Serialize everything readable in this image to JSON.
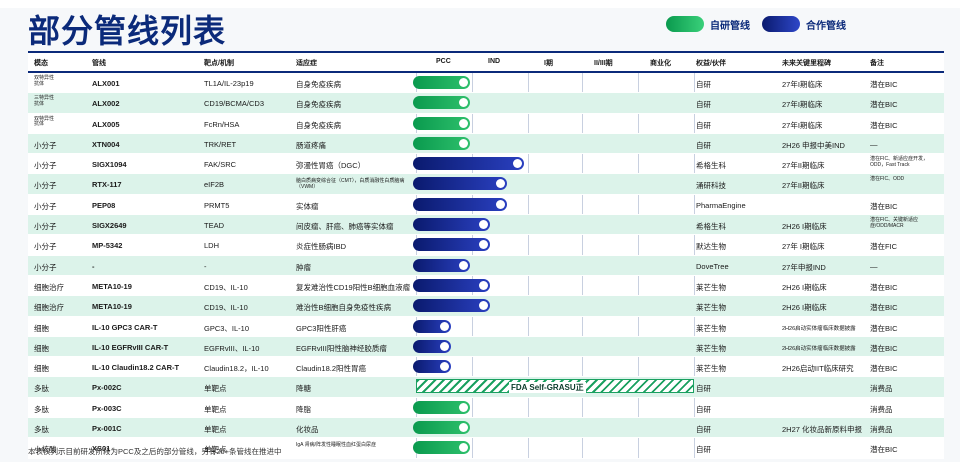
{
  "title": "部分管线列表",
  "legend": {
    "own": "自研管线",
    "coop": "合作管线"
  },
  "headers": {
    "modality": "模态",
    "pipeline": "管线",
    "target": "靶点/机制",
    "indication": "适应症",
    "pcc": "PCC",
    "ind": "IND",
    "phase1": "I期",
    "phase23": "II/III期",
    "commercial": "商业化",
    "partner": "权益/伙伴",
    "milestone": "未来关键里程碑",
    "note": "备注"
  },
  "rows": [
    {
      "modality": "双特异性抗体",
      "pipeline": "ALX001",
      "target": "TL1A/IL-23p19",
      "indication": "自身免疫疾病",
      "type": "own",
      "progress": 0.305,
      "partner": "自研",
      "milestone": "27年I期临床",
      "note": "潜在BIC"
    },
    {
      "modality": "三特异性抗体",
      "pipeline": "ALX002",
      "target": "CD19/BCMA/CD3",
      "indication": "自身免疫疾病",
      "type": "own",
      "progress": 0.305,
      "partner": "自研",
      "milestone": "27年I期临床",
      "note": "潜在BIC"
    },
    {
      "modality": "双特异性抗体",
      "pipeline": "ALX005",
      "target": "FcRn/HSA",
      "indication": "自身免疫疾病",
      "type": "own",
      "progress": 0.305,
      "partner": "自研",
      "milestone": "27年I期临床",
      "note": "潜在BIC"
    },
    {
      "modality": "小分子",
      "pipeline": "XTN004",
      "target": "TRK/RET",
      "indication": "肠道疼痛",
      "type": "own",
      "progress": 0.305,
      "partner": "自研",
      "milestone": "2H26 申报中美IND",
      "note": "—"
    },
    {
      "modality": "小分子",
      "pipeline": "SIGX1094",
      "target": "FAK/SRC",
      "indication": "弥漫性胃癌（DGC）",
      "type": "coop",
      "progress": 0.59,
      "partner": "希格生科",
      "milestone": "27年II期临床",
      "note": "潜在FIC、新适应症开发，ODD，Fast Track"
    },
    {
      "modality": "小分子",
      "pipeline": "RTX-117",
      "target": "eIF2B",
      "indication": "脑白质病变综合征（CMT），白质消融性白质脑病（VWM）",
      "type": "coop",
      "progress": 0.5,
      "partner": "涌研科技",
      "milestone": "27年II期临床",
      "note": "潜在FIC、ODD"
    },
    {
      "modality": "小分子",
      "pipeline": "PEP08",
      "target": "PRMT5",
      "indication": "实体瘤",
      "type": "coop",
      "progress": 0.5,
      "partner": "PharmaEngine",
      "milestone": "",
      "note": "潜在BIC"
    },
    {
      "modality": "小分子",
      "pipeline": "SIGX2649",
      "target": "TEAD",
      "indication": "间皮瘤、肝癌、肺癌等实体瘤",
      "type": "coop",
      "progress": 0.41,
      "partner": "希格生科",
      "milestone": "2H26 I期临床",
      "note": "潜在FIC、关键新适应症/ODD/MACR"
    },
    {
      "modality": "小分子",
      "pipeline": "MP-5342",
      "target": "LDH",
      "indication": "炎症性肠病IBD",
      "type": "coop",
      "progress": 0.41,
      "partner": "默达生物",
      "milestone": "27年 I期临床",
      "note": "潜在FIC"
    },
    {
      "modality": "小分子",
      "pipeline": "-",
      "target": "-",
      "indication": "肿瘤",
      "type": "coop",
      "progress": 0.305,
      "partner": "DoveTree",
      "milestone": "27年申报IND",
      "note": "—"
    },
    {
      "modality": "细胞治疗",
      "pipeline": "META10-19",
      "target": "CD19、IL-10",
      "indication": "复发难治性CD19阳性B细胞血液瘤",
      "type": "coop",
      "progress": 0.41,
      "partner": "莱芒生物",
      "milestone": "2H26 I期临床",
      "note": "潜在BIC"
    },
    {
      "modality": "细胞治疗",
      "pipeline": "META10-19",
      "target": "CD19、IL-10",
      "indication": "难治性B细胞自身免疫性疾病",
      "type": "coop",
      "progress": 0.41,
      "partner": "莱芒生物",
      "milestone": "2H26 I期临床",
      "note": "潜在BIC"
    },
    {
      "modality": "细胞",
      "pipeline": "IL-10 GPC3 CAR-T",
      "target": "GPC3、IL-10",
      "indication": "GPC3阳性肝癌",
      "type": "coop",
      "progress": 0.205,
      "partner": "莱芒生物",
      "milestone": "2H26启动实体瘤临床数据披露",
      "note": "潜在BIC"
    },
    {
      "modality": "细胞",
      "pipeline": "IL-10 EGFRvIII CAR-T",
      "target": "EGFRvIII、IL-10",
      "indication": "EGFRvIII阳性脑神经胶质瘤",
      "type": "coop",
      "progress": 0.205,
      "partner": "莱芒生物",
      "milestone": "2H26启动实体瘤临床数据披露",
      "note": "潜在BIC"
    },
    {
      "modality": "细胞",
      "pipeline": "IL-10 Claudin18.2 CAR-T",
      "target": "Claudin18.2，IL-10",
      "indication": "Claudin18.2阳性胃癌",
      "type": "coop",
      "progress": 0.205,
      "partner": "莱芒生物",
      "milestone": "2H26启动IIT临床研究",
      "note": "潜在BIC"
    },
    {
      "modality": "多肽",
      "pipeline": "Px-002C",
      "target": "单靶点",
      "indication": "降糖",
      "type": "hatch",
      "progress": 0,
      "hatch_label": "FDA Self-GRASU正",
      "partner": "自研",
      "milestone": "",
      "note": "消费品"
    },
    {
      "modality": "多肽",
      "pipeline": "Px-003C",
      "target": "单靶点",
      "indication": "降脂",
      "type": "own",
      "progress": 0.305,
      "partner": "自研",
      "milestone": "",
      "note": "消费品"
    },
    {
      "modality": "多肽",
      "pipeline": "Px-001C",
      "target": "单靶点",
      "indication": "化妆品",
      "type": "own",
      "progress": 0.305,
      "partner": "自研",
      "milestone": "2H27 化妆品新原料申报",
      "note": "消费品"
    },
    {
      "modality": "小核酸",
      "pipeline": "XS01",
      "target": "单靶点",
      "indication": "IgA 肾病/阵发性睡眠性血红蛋白尿症",
      "type": "own",
      "progress": 0.305,
      "partner": "自研",
      "milestone": "",
      "note": "潜在BIC"
    }
  ],
  "footnote": "本表仅列示目前研发阶段为PCC及之后的部分管线，另有20+条管线在推进中"
}
